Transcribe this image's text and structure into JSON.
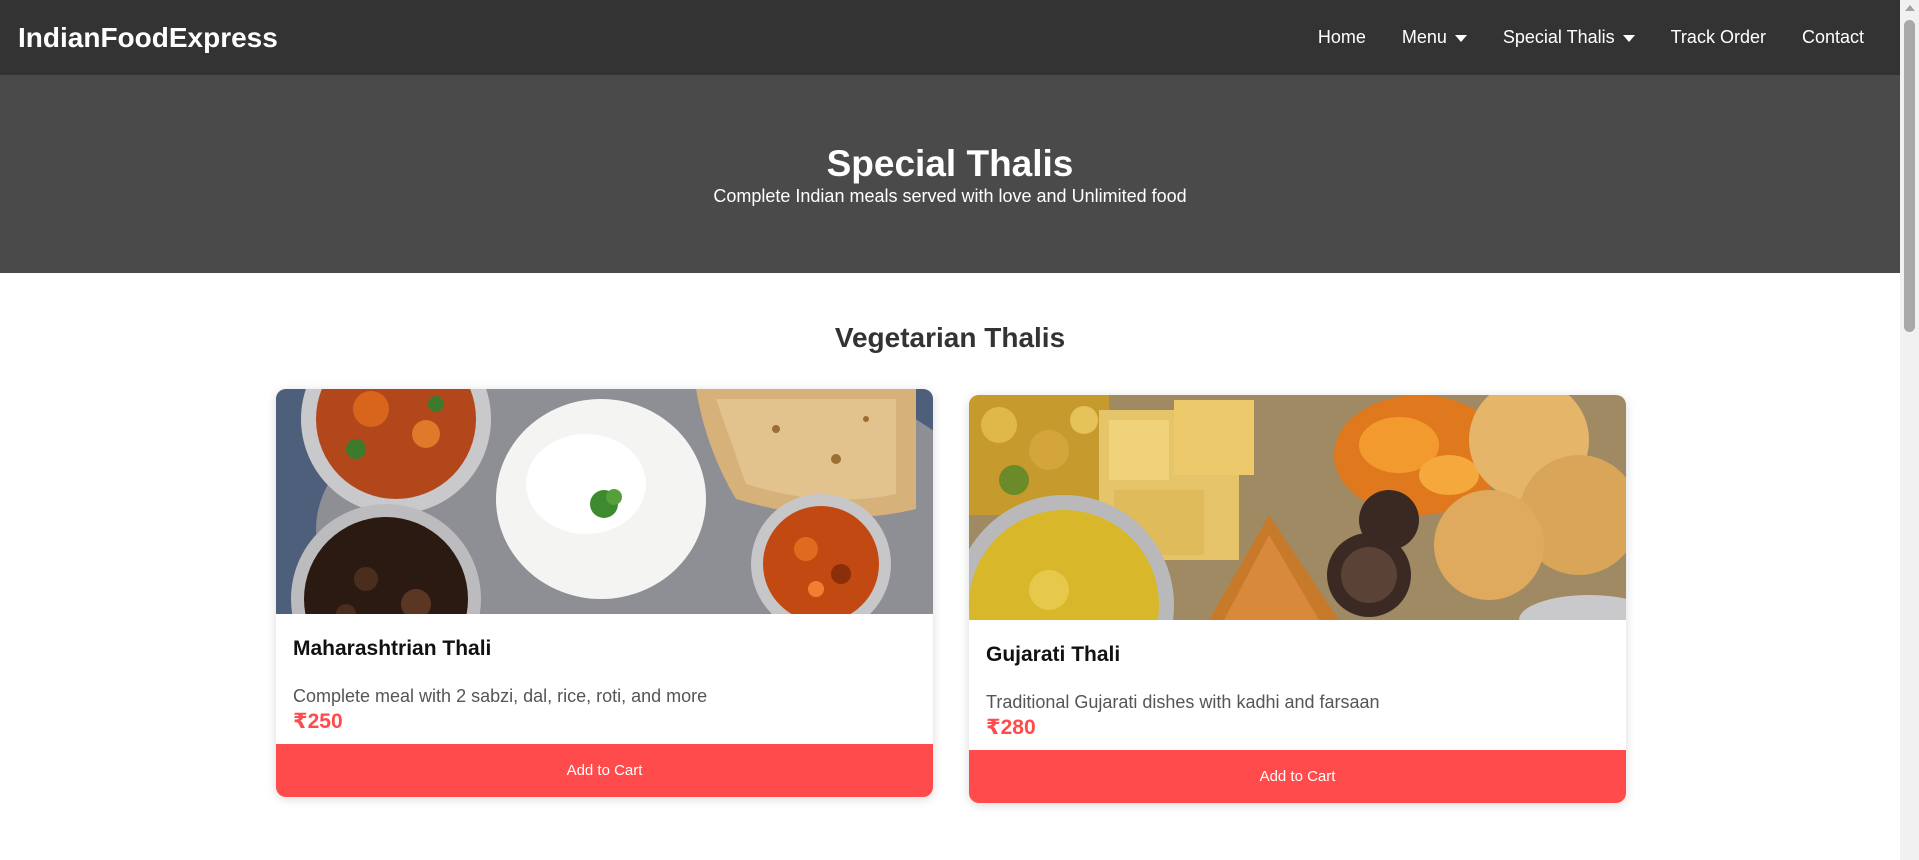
{
  "brand": {
    "name": "IndianFoodExpress"
  },
  "nav": {
    "home": "Home",
    "menu": "Menu",
    "special_thalis": "Special Thalis",
    "track_order": "Track Order",
    "contact": "Contact"
  },
  "hero": {
    "title": "Special Thalis",
    "subtitle": "Complete Indian meals served with love and Unlimited food"
  },
  "section": {
    "title": "Vegetarian Thalis"
  },
  "cards": [
    {
      "title": "Maharashtrian Thali",
      "description": "Complete meal with 2 sabzi, dal, rice, roti, and more",
      "price": "₹250",
      "button": "Add to Cart"
    },
    {
      "title": "Gujarati Thali",
      "description": "Traditional Gujarati dishes with kadhi and farsaan",
      "price": "₹280",
      "button": "Add to Cart"
    }
  ],
  "colors": {
    "navbar": "#333333",
    "hero": "#4a4a4a",
    "accent": "#ff4b4b",
    "text_dark": "#333333"
  },
  "icons": {
    "menu_caret": "caret-down-icon",
    "special_caret": "caret-down-icon"
  }
}
